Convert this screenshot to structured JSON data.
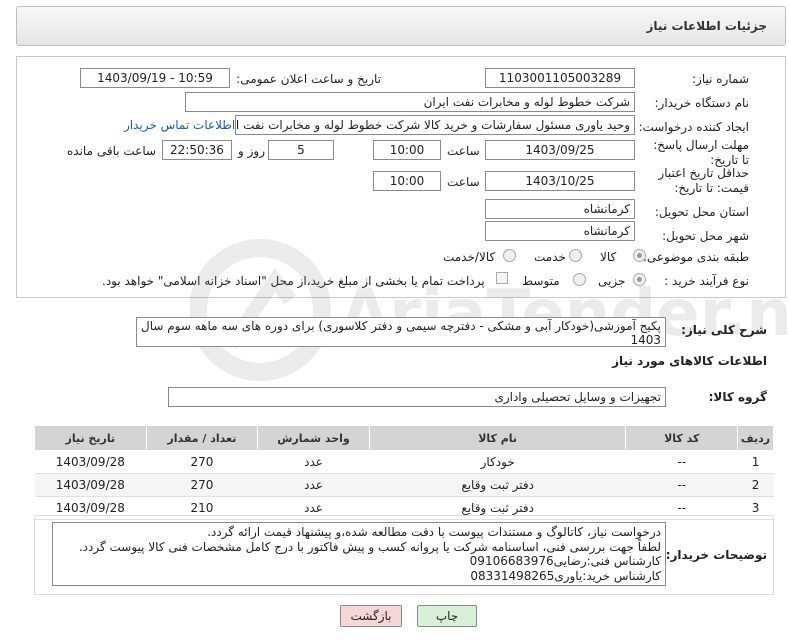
{
  "header": {
    "title": "جزئیات اطلاعات نیاز"
  },
  "form": {
    "need_number": {
      "label": "شماره نیاز:",
      "value": "1103001105003289"
    },
    "announce_datetime": {
      "label": "تاریخ و ساعت اعلان عمومی:",
      "value": "1403/09/19 - 10:59"
    },
    "buyer_org": {
      "label": "نام دستگاه خریدار:",
      "value": "شرکت خطوط لوله و مخابرات نفت ایران"
    },
    "requester": {
      "label": "ایجاد کننده درخواست:",
      "value": "وحید یاوری مسئول سفارشات و خرید کالا  شرکت خطوط لوله و مخابرات نفت ایرا",
      "contact_link": "اطلاعات تماس خریدار"
    },
    "reply_deadline": {
      "label": "مهلت ارسال پاسخ: تا تاریخ:",
      "date": "1403/09/25",
      "time_label": "ساعت",
      "time": "10:00",
      "days": "5",
      "days_label": "روز و",
      "remaining": "22:50:36",
      "remaining_label": "ساعت باقی مانده"
    },
    "price_validity": {
      "label": "حداقل تاریخ اعتبار قیمت: تا تاریخ:",
      "date": "1403/10/25",
      "time_label": "ساعت",
      "time": "10:00"
    },
    "province": {
      "label": "استان محل تحویل:",
      "value": "کرمانشاه"
    },
    "city": {
      "label": "شهر محل تحویل:",
      "value": "کرمانشاه"
    },
    "category": {
      "label": "طبقه بندی موضوعی:",
      "options": [
        "کالا",
        "خدمت",
        "کالا/خدمت"
      ],
      "selected": "کالا"
    },
    "purchase_type": {
      "label": "نوع فرآیند خرید :",
      "options": [
        "جزیی",
        "متوسط"
      ],
      "selected": "جزیی",
      "payment_note": "پرداخت تمام یا بخشی از مبلغ خرید،از محل \"اسناد خزانه اسلامی\" خواهد بود."
    }
  },
  "description": {
    "label": "شرح کلی نیاز:",
    "value": "پکیج آموزشی(خودکار آبی و مشکی - دفترچه سیمی و دفتر کلاسوری) برای دوره های سه ماهه سوم سال 1403"
  },
  "goods_section": {
    "title": "اطلاعات کالاهای مورد نیاز",
    "group_label": "گروه کالا:",
    "group_value": "تجهیزات و وسایل تحصیلی واداری"
  },
  "table": {
    "headers": [
      "ردیف",
      "کد کالا",
      "نام کالا",
      "واحد شمارش",
      "تعداد / مقدار",
      "تاریخ نیاز"
    ],
    "rows": [
      [
        "1",
        "--",
        "خودکار",
        "عدد",
        "270",
        "1403/09/28"
      ],
      [
        "2",
        "--",
        "دفتر ثبت وقایع",
        "عدد",
        "270",
        "1403/09/28"
      ],
      [
        "3",
        "--",
        "دفتر ثبت وقایع",
        "عدد",
        "210",
        "1403/09/28"
      ]
    ]
  },
  "notes": {
    "label": "توضیحات خریدار:",
    "lines": [
      "درخواست نیاز، کاتالوگ و مستندات پیوست با دقت مطالعه شده،و پیشنهاد قیمت ارائه گردد.",
      "لطفاً جهت بررسی فنی، اساسنامه شرکت یا پروانه کسب و پیش فاکتور با درج کامل مشخصات فنی کالا پیوست گردد.",
      "کارشناس فنی:رضایی09106683976",
      "کارشناس خرید:یاوری08331498265"
    ]
  },
  "buttons": {
    "print": "چاپ",
    "back": "بازگشت"
  },
  "watermark": {
    "text": "AriaTender.neT"
  },
  "colors": {
    "link": "#1a5bbf",
    "back_button": "#f6d6d6",
    "print_button": "#d8f0d6"
  }
}
